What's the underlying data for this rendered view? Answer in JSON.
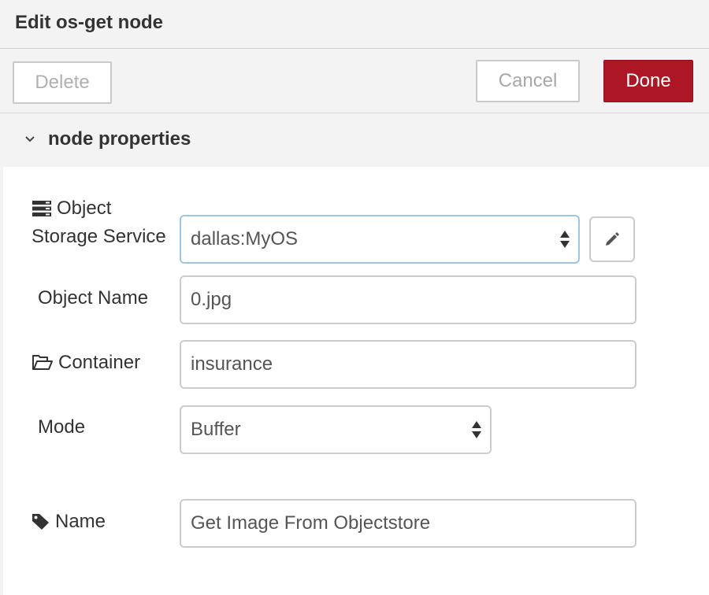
{
  "tray": {
    "title": "Edit os-get node"
  },
  "toolbar": {
    "delete_label": "Delete",
    "cancel_label": "Cancel",
    "done_label": "Done"
  },
  "section": {
    "title": "node properties"
  },
  "form": {
    "service": {
      "label_line1": "Object",
      "label_line2": "Storage Service",
      "value": "dallas:MyOS",
      "icon": "server-icon"
    },
    "object_name": {
      "label": "Object Name",
      "value": "0.jpg"
    },
    "container": {
      "label": "Container",
      "value": "insurance",
      "icon": "folder-open-icon"
    },
    "mode": {
      "label": "Mode",
      "value": "Buffer"
    },
    "name": {
      "label": "Name",
      "value": "Get Image From Objectstore",
      "icon": "tag-icon"
    }
  },
  "colors": {
    "done": "#ad1625",
    "panel": "#f3f3f3",
    "focus_border": "#9cc6e6"
  }
}
